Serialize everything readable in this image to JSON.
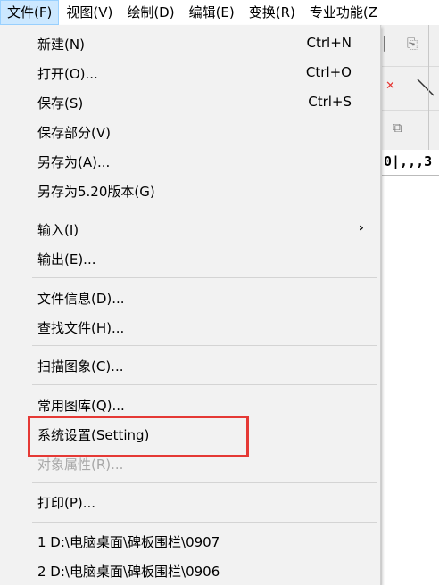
{
  "menubar": {
    "items": [
      "文件(F)",
      "视图(V)",
      "绘制(D)",
      "编辑(E)",
      "变换(R)",
      "专业功能(Z"
    ]
  },
  "file_menu": {
    "items": [
      {
        "label": "新建(N)",
        "shortcut": "Ctrl+N"
      },
      {
        "label": "打开(O)...",
        "shortcut": "Ctrl+O"
      },
      {
        "label": "保存(S)",
        "shortcut": "Ctrl+S"
      },
      {
        "label": "保存部分(V)"
      },
      {
        "label": "另存为(A)..."
      },
      {
        "label": "另存为5.20版本(G)"
      },
      {
        "label": "输入(I)",
        "submenu": "›"
      },
      {
        "label": "输出(E)..."
      },
      {
        "label": "文件信息(D)..."
      },
      {
        "label": "查找文件(H)..."
      },
      {
        "label": "扫描图象(C)..."
      },
      {
        "label": "常用图库(Q)..."
      },
      {
        "label": "系统设置(Setting)"
      },
      {
        "label": "对象属性(R)...",
        "disabled": true
      },
      {
        "label": "打印(P)..."
      },
      {
        "label": "1 D:\\电脑桌面\\碑板围栏\\0907"
      },
      {
        "label": "2 D:\\电脑桌面\\碑板围栏\\0906"
      }
    ]
  },
  "ruler": {
    "text": "0|,,,3"
  },
  "highlight": {
    "color": "#e53935"
  }
}
